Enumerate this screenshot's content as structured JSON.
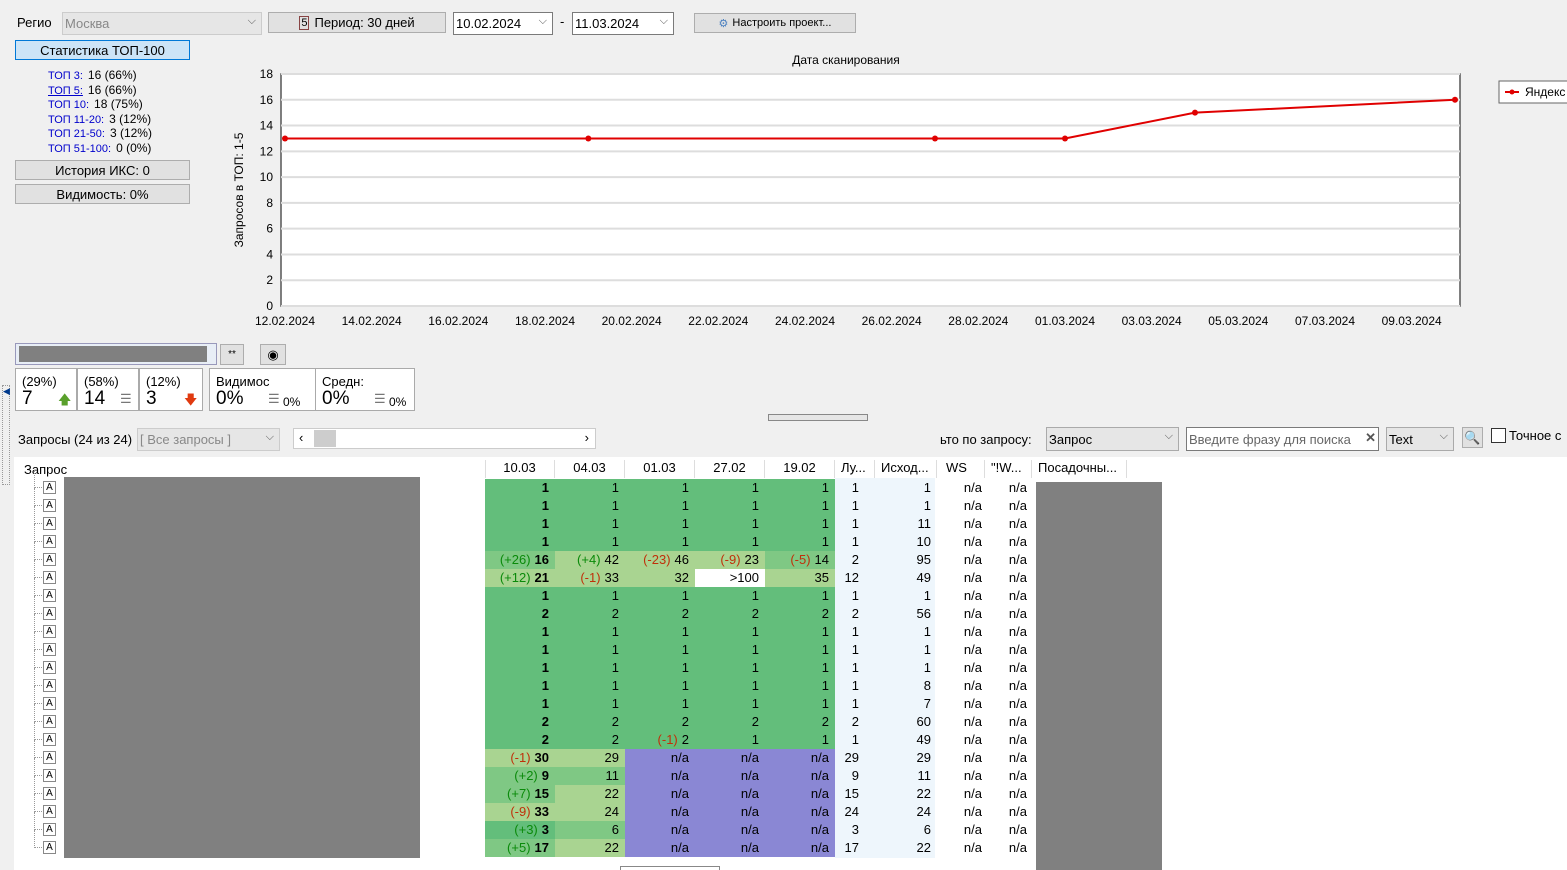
{
  "toolbar": {
    "region_label": "Регио",
    "region_value": "Москва",
    "period_label": "Период: 30 дней",
    "date_from": "10.02.2024",
    "date_sep": "-",
    "date_to": "11.03.2024",
    "configure_label": "Настроить проект..."
  },
  "stats": {
    "title": "Статистика ТОП-100",
    "items": [
      {
        "k": "ТОП 3:",
        "v": "16 (66%)"
      },
      {
        "k": "ТОП 5:",
        "v": "16 (66%)"
      },
      {
        "k": "ТОП 10:",
        "v": "18 (75%)"
      },
      {
        "k": "ТОП 11-20:",
        "v": "3 (12%)"
      },
      {
        "k": "ТОП 21-50:",
        "v": "3 (12%)"
      },
      {
        "k": "ТОП 51-100:",
        "v": "0 (0%)"
      }
    ],
    "iks": "История ИКС: 0",
    "visibility": "Видимость: 0%"
  },
  "chart_data": {
    "type": "line",
    "title": "Дата сканирования",
    "ylabel": "Запросов в ТОП: 1-5",
    "xlabel": "",
    "ylim": [
      0,
      18
    ],
    "yticks": [
      0,
      2,
      4,
      6,
      8,
      10,
      12,
      14,
      16,
      18
    ],
    "xlim": [
      "12.02.2024",
      "10.03.2024"
    ],
    "xticks": [
      "12.02.2024",
      "14.02.2024",
      "16.02.2024",
      "18.02.2024",
      "20.02.2024",
      "22.02.2024",
      "24.02.2024",
      "26.02.2024",
      "28.02.2024",
      "01.03.2024",
      "03.03.2024",
      "05.03.2024",
      "07.03.2024",
      "09.03.2024"
    ],
    "grid": true,
    "legend": "right",
    "series": [
      {
        "name": "Яндекс",
        "color": "#e00000",
        "x": [
          "12.02.2024",
          "19.02.2024",
          "27.02.2024",
          "01.03.2024",
          "04.03.2024",
          "10.03.2024"
        ],
        "y": [
          13,
          13,
          13,
          13,
          15,
          16
        ]
      }
    ]
  },
  "cards": [
    {
      "p": "(29%)",
      "v": "7",
      "icon": "arrow-up"
    },
    {
      "p": "(58%)",
      "v": "14",
      "icon": "equal"
    },
    {
      "p": "(12%)",
      "v": "3",
      "icon": "arrow-down"
    }
  ],
  "vis_card": {
    "label": "Видимос",
    "value": "0%",
    "delta": "0%"
  },
  "avg_card": {
    "label": "Средн:",
    "value": "0%",
    "delta": "0%"
  },
  "filter": {
    "queries_label": "Запросы (24 из 24)",
    "group_value": "[ Все запросы ]",
    "search_by_label": "ьто по запросу:",
    "search_by_value": "Запрос",
    "search_placeholder": "Введите фразу для поиска",
    "mode_value": "Text",
    "exact_label": "Точное с"
  },
  "table": {
    "headers": {
      "query": "Запрос",
      "dates": [
        "10.03",
        "04.03",
        "01.03",
        "27.02",
        "19.02"
      ],
      "best": "Лу...",
      "orig": "Исход...",
      "ws": "WS",
      "ws2": "\"!W...",
      "landing": "Посадочны..."
    },
    "rows": [
      {
        "c": [
          [
            "",
            1
          ],
          [
            "",
            1
          ],
          [
            "",
            1
          ],
          [
            "",
            1
          ],
          [
            "",
            1
          ]
        ],
        "b": "1",
        "o": "1"
      },
      {
        "c": [
          [
            "",
            1
          ],
          [
            "",
            1
          ],
          [
            "",
            1
          ],
          [
            "",
            1
          ],
          [
            "",
            1
          ]
        ],
        "b": "1",
        "o": "1"
      },
      {
        "c": [
          [
            "",
            1
          ],
          [
            "",
            1
          ],
          [
            "",
            1
          ],
          [
            "",
            1
          ],
          [
            "",
            1
          ]
        ],
        "b": "1",
        "o": "11"
      },
      {
        "c": [
          [
            "",
            1
          ],
          [
            "",
            1
          ],
          [
            "",
            1
          ],
          [
            "",
            1
          ],
          [
            "",
            1
          ]
        ],
        "b": "1",
        "o": "10"
      },
      {
        "c": [
          [
            "(+26)",
            16
          ],
          [
            "(+4)",
            42
          ],
          [
            "(-23)",
            46
          ],
          [
            "(-9)",
            23
          ],
          [
            "(-5)",
            14
          ]
        ],
        "b": "2",
        "o": "95"
      },
      {
        "c": [
          [
            "(+12)",
            21
          ],
          [
            "(-1)",
            33
          ],
          [
            "",
            32
          ],
          [
            "",
            ">100"
          ],
          [
            "",
            35
          ]
        ],
        "b": "12",
        "o": "49"
      },
      {
        "c": [
          [
            "",
            1
          ],
          [
            "",
            1
          ],
          [
            "",
            1
          ],
          [
            "",
            1
          ],
          [
            "",
            1
          ]
        ],
        "b": "1",
        "o": "1"
      },
      {
        "c": [
          [
            "",
            2
          ],
          [
            "",
            2
          ],
          [
            "",
            2
          ],
          [
            "",
            2
          ],
          [
            "",
            2
          ]
        ],
        "b": "2",
        "o": "56"
      },
      {
        "c": [
          [
            "",
            1
          ],
          [
            "",
            1
          ],
          [
            "",
            1
          ],
          [
            "",
            1
          ],
          [
            "",
            1
          ]
        ],
        "b": "1",
        "o": "1"
      },
      {
        "c": [
          [
            "",
            1
          ],
          [
            "",
            1
          ],
          [
            "",
            1
          ],
          [
            "",
            1
          ],
          [
            "",
            1
          ]
        ],
        "b": "1",
        "o": "1"
      },
      {
        "c": [
          [
            "",
            1
          ],
          [
            "",
            1
          ],
          [
            "",
            1
          ],
          [
            "",
            1
          ],
          [
            "",
            1
          ]
        ],
        "b": "1",
        "o": "1"
      },
      {
        "c": [
          [
            "",
            1
          ],
          [
            "",
            1
          ],
          [
            "",
            1
          ],
          [
            "",
            1
          ],
          [
            "",
            1
          ]
        ],
        "b": "1",
        "o": "8"
      },
      {
        "c": [
          [
            "",
            1
          ],
          [
            "",
            1
          ],
          [
            "",
            1
          ],
          [
            "",
            1
          ],
          [
            "",
            1
          ]
        ],
        "b": "1",
        "o": "7"
      },
      {
        "c": [
          [
            "",
            2
          ],
          [
            "",
            2
          ],
          [
            "",
            2
          ],
          [
            "",
            2
          ],
          [
            "",
            2
          ]
        ],
        "b": "2",
        "o": "60"
      },
      {
        "c": [
          [
            "",
            2
          ],
          [
            "",
            2
          ],
          [
            "(-1)",
            2
          ],
          [
            "",
            1
          ],
          [
            "",
            1
          ]
        ],
        "b": "1",
        "o": "49"
      },
      {
        "c": [
          [
            "(-1)",
            30
          ],
          [
            "",
            29
          ],
          [
            "",
            "n/a"
          ],
          [
            "",
            "n/a"
          ],
          [
            "",
            "n/a"
          ]
        ],
        "b": "29",
        "o": "29"
      },
      {
        "c": [
          [
            "(+2)",
            9
          ],
          [
            "",
            11
          ],
          [
            "",
            "n/a"
          ],
          [
            "",
            "n/a"
          ],
          [
            "",
            "n/a"
          ]
        ],
        "b": "9",
        "o": "11"
      },
      {
        "c": [
          [
            "(+7)",
            15
          ],
          [
            "",
            22
          ],
          [
            "",
            "n/a"
          ],
          [
            "",
            "n/a"
          ],
          [
            "",
            "n/a"
          ]
        ],
        "b": "15",
        "o": "22"
      },
      {
        "c": [
          [
            "(-9)",
            33
          ],
          [
            "",
            24
          ],
          [
            "",
            "n/a"
          ],
          [
            "",
            "n/a"
          ],
          [
            "",
            "n/a"
          ]
        ],
        "b": "24",
        "o": "24"
      },
      {
        "c": [
          [
            "(+3)",
            3
          ],
          [
            "",
            6
          ],
          [
            "",
            "n/a"
          ],
          [
            "",
            "n/a"
          ],
          [
            "",
            "n/a"
          ]
        ],
        "b": "3",
        "o": "6"
      },
      {
        "c": [
          [
            "(+5)",
            17
          ],
          [
            "",
            22
          ],
          [
            "",
            "n/a"
          ],
          [
            "",
            "n/a"
          ],
          [
            "",
            "n/a"
          ]
        ],
        "b": "17",
        "o": "22"
      }
    ],
    "na": "n/a"
  }
}
